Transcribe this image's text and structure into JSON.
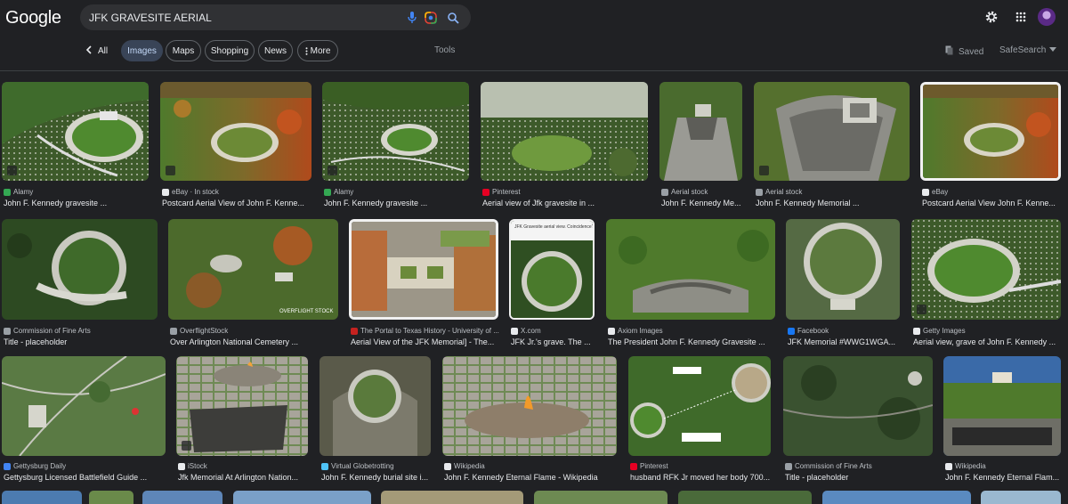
{
  "logo": "Google",
  "search": {
    "query": "JFK GRAVESITE AERIAL"
  },
  "tabs": {
    "back": "All",
    "images": "Images",
    "maps": "Maps",
    "shopping": "Shopping",
    "news": "News",
    "more": "More",
    "tools": "Tools"
  },
  "right": {
    "saved": "Saved",
    "safesearch": "SafeSearch"
  },
  "results": [
    {
      "source": "Alamy",
      "caption": "John F. Kennedy gravesite ...",
      "fav": "#34a853"
    },
    {
      "source": "eBay · In stock",
      "caption": "Postcard Aerial View of John F. Kenne...",
      "fav": "#e8eaed"
    },
    {
      "source": "Alamy",
      "caption": "John F. Kennedy gravesite ...",
      "fav": "#34a853"
    },
    {
      "source": "Pinterest",
      "caption": "Aerial view of Jfk gravesite in ...",
      "fav": "#e60023"
    },
    {
      "source": "Aerial stock",
      "caption": "John F. Kennedy Me...",
      "fav": "#9aa0a6"
    },
    {
      "source": "Aerial stock",
      "caption": "John F. Kennedy Memorial ...",
      "fav": "#9aa0a6"
    },
    {
      "source": "eBay",
      "caption": "Postcard Aerial View John F. Kenne...",
      "fav": "#e8eaed"
    },
    {
      "source": "Commission of Fine Arts",
      "caption": "Title - placeholder",
      "fav": "#9aa0a6"
    },
    {
      "source": "OverflightStock",
      "caption": "Over Arlington National Cemetery ...",
      "fav": "#9aa0a6"
    },
    {
      "source": "The Portal to Texas History - University of ...",
      "caption": "Aerial View of the JFK Memorial] - The...",
      "fav": "#c5221f"
    },
    {
      "source": "X.com",
      "caption": "JFK Jr.'s grave. The ...",
      "fav": "#e8eaed"
    },
    {
      "source": "Axiom Images",
      "caption": "The President John F. Kennedy Gravesite ...",
      "fav": "#e8eaed"
    },
    {
      "source": "Facebook",
      "caption": "JFK Memorial #WWG1WGA...",
      "fav": "#1877f2"
    },
    {
      "source": "Getty Images",
      "caption": "Aerial view, grave of John F. Kennedy ...",
      "fav": "#e8eaed"
    },
    {
      "source": "Gettysburg Daily",
      "caption": "Gettysburg Licensed Battlefield Guide ...",
      "fav": "#4285f4"
    },
    {
      "source": "iStock",
      "caption": "Jfk Memorial At Arlington Nation...",
      "fav": "#e8eaed"
    },
    {
      "source": "Virtual Globetrotting",
      "caption": "John F. Kennedy burial site i...",
      "fav": "#4fc3f7"
    },
    {
      "source": "Wikipedia",
      "caption": "John F. Kennedy Eternal Flame - Wikipedia",
      "fav": "#e8eaed"
    },
    {
      "source": "Pinterest",
      "caption": "husband RFK Jr moved her body 700...",
      "fav": "#e60023"
    },
    {
      "source": "Commission of Fine Arts",
      "caption": "Title - placeholder",
      "fav": "#9aa0a6"
    },
    {
      "source": "Wikipedia",
      "caption": "John F. Kennedy Eternal Flam...",
      "fav": "#e8eaed"
    }
  ]
}
